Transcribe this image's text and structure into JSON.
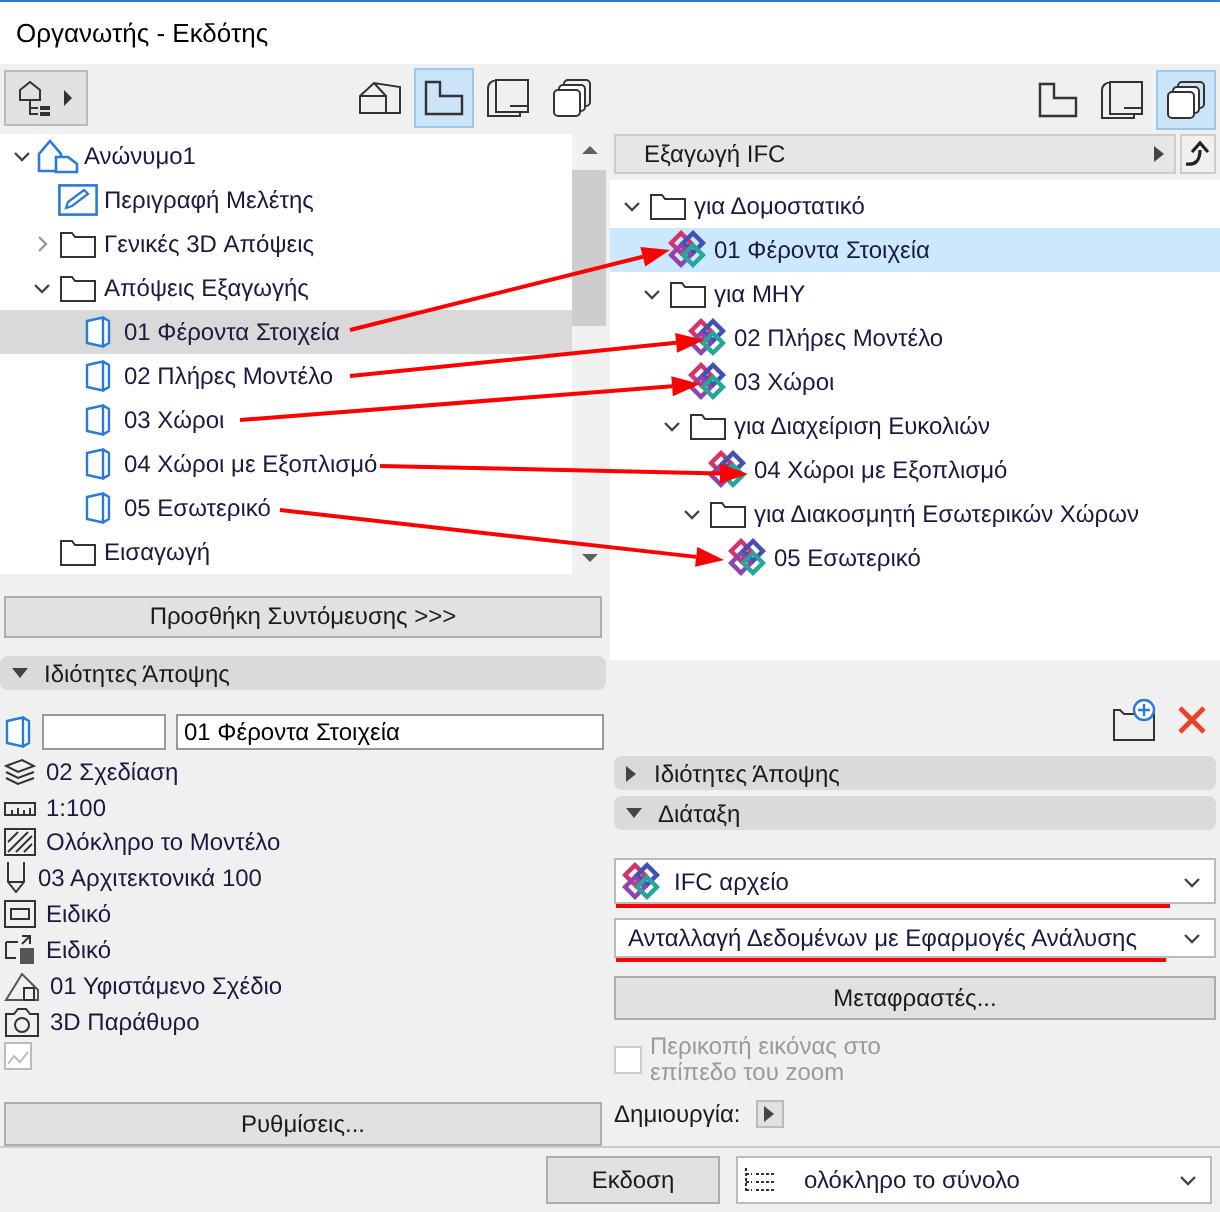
{
  "window": {
    "title": "Οργανωτής - Εκδότης"
  },
  "left_panel": {
    "toolbar": [
      {
        "kind": "map_menu",
        "selected": false
      },
      {
        "kind": "project_map",
        "selected": false
      },
      {
        "kind": "view_map",
        "selected": true
      },
      {
        "kind": "layout_book",
        "selected": false
      },
      {
        "kind": "publisher_sets",
        "selected": false
      }
    ],
    "tree": [
      {
        "label": "Ανώνυμο1",
        "kind": "project",
        "expanded": true,
        "selected": false,
        "children": [
          {
            "label": "Περιγραφή Μελέτης",
            "kind": "document",
            "selected": false
          },
          {
            "label": "Γενικές 3D Απόψεις",
            "kind": "folder",
            "expanded": false,
            "selected": false
          },
          {
            "label": "Απόψεις Εξαγωγής",
            "kind": "folder",
            "expanded": true,
            "selected": false,
            "children": [
              {
                "label": "01 Φέροντα Στοιχεία",
                "kind": "view",
                "selected": true
              },
              {
                "label": "02 Πλήρες Μοντέλο",
                "kind": "view",
                "selected": false
              },
              {
                "label": "03 Χώροι",
                "kind": "view",
                "selected": false
              },
              {
                "label": "04 Χώροι με Εξοπλισμό",
                "kind": "view",
                "selected": false
              },
              {
                "label": "05 Εσωτερικό",
                "kind": "view",
                "selected": false
              }
            ]
          },
          {
            "label": "Εισαγωγή",
            "kind": "folder",
            "selected": false
          }
        ]
      }
    ],
    "shortcut_button": "Προσθήκη Συντόμευσης >>>",
    "properties": {
      "title": "Ιδιότητες Άποψης",
      "expanded": true,
      "name": "01 Φέροντα Στοιχεία",
      "items": [
        {
          "kind": "layers",
          "text": "02 Σχεδίαση"
        },
        {
          "kind": "scale",
          "text": "1:100"
        },
        {
          "kind": "structure",
          "text": "Ολόκληρο το Μοντέλο"
        },
        {
          "kind": "pen",
          "text": "03 Αρχιτεκτονικά 100"
        },
        {
          "kind": "model",
          "text": "Ειδικό"
        },
        {
          "kind": "override",
          "text": "Ειδικό"
        },
        {
          "kind": "renovation",
          "text": "01 Υφιστάμενο Σχέδιο"
        },
        {
          "kind": "camera",
          "text": "3D Παράθυρο"
        },
        {
          "kind": "image"
        }
      ]
    },
    "settings_button": "Ρυθμίσεις..."
  },
  "right_panel": {
    "toolbar": [
      {
        "kind": "view_map",
        "selected": false
      },
      {
        "kind": "layout_book",
        "selected": false
      },
      {
        "kind": "publisher_sets",
        "selected": true
      }
    ],
    "path": "Εξαγωγή IFC",
    "tree": [
      {
        "label": "για Δομοστατικό",
        "kind": "folder",
        "expanded": true,
        "selected": false,
        "children": [
          {
            "label": "01 Φέροντα Στοιχεία",
            "kind": "ifc",
            "selected": true
          },
          {
            "label": "για ΜΗΥ",
            "kind": "folder",
            "expanded": true,
            "selected": false,
            "children": [
              {
                "label": "02 Πλήρες Μοντέλο",
                "kind": "ifc",
                "selected": false
              },
              {
                "label": "03 Χώροι",
                "kind": "ifc",
                "selected": false
              },
              {
                "label": "για Διαχείριση Ευκολιών",
                "kind": "folder",
                "expanded": true,
                "selected": false,
                "children": [
                  {
                    "label": "04 Χώροι με Εξοπλισμό",
                    "kind": "ifc",
                    "selected": false
                  },
                  {
                    "label": "για Διακοσμητή Εσωτερικών Χώρων",
                    "kind": "folder",
                    "expanded": true,
                    "selected": false,
                    "children": [
                      {
                        "label": "05 Εσωτερικό",
                        "kind": "ifc",
                        "selected": false
                      }
                    ]
                  }
                ]
              }
            ]
          }
        ]
      }
    ],
    "sections": [
      {
        "title": "Ιδιότητες Άποψης",
        "expanded": false
      },
      {
        "title": "Διάταξη",
        "expanded": true
      }
    ],
    "format": {
      "value": "IFC αρχείο"
    },
    "translator": {
      "value": "Ανταλλαγή Δεδομένων με Εφαρμογές Ανάλυσης"
    },
    "translators_button": "Μεταφραστές...",
    "crop_checkbox": {
      "label": "Περικοπή εικόνας στο επίπεδο του zoom",
      "checked": false,
      "disabled": true
    },
    "create_label": "Δημιουργία:"
  },
  "bottom_bar": {
    "publish_button": "Εκδοση",
    "scope": "ολόκληρο το σύνολο"
  }
}
